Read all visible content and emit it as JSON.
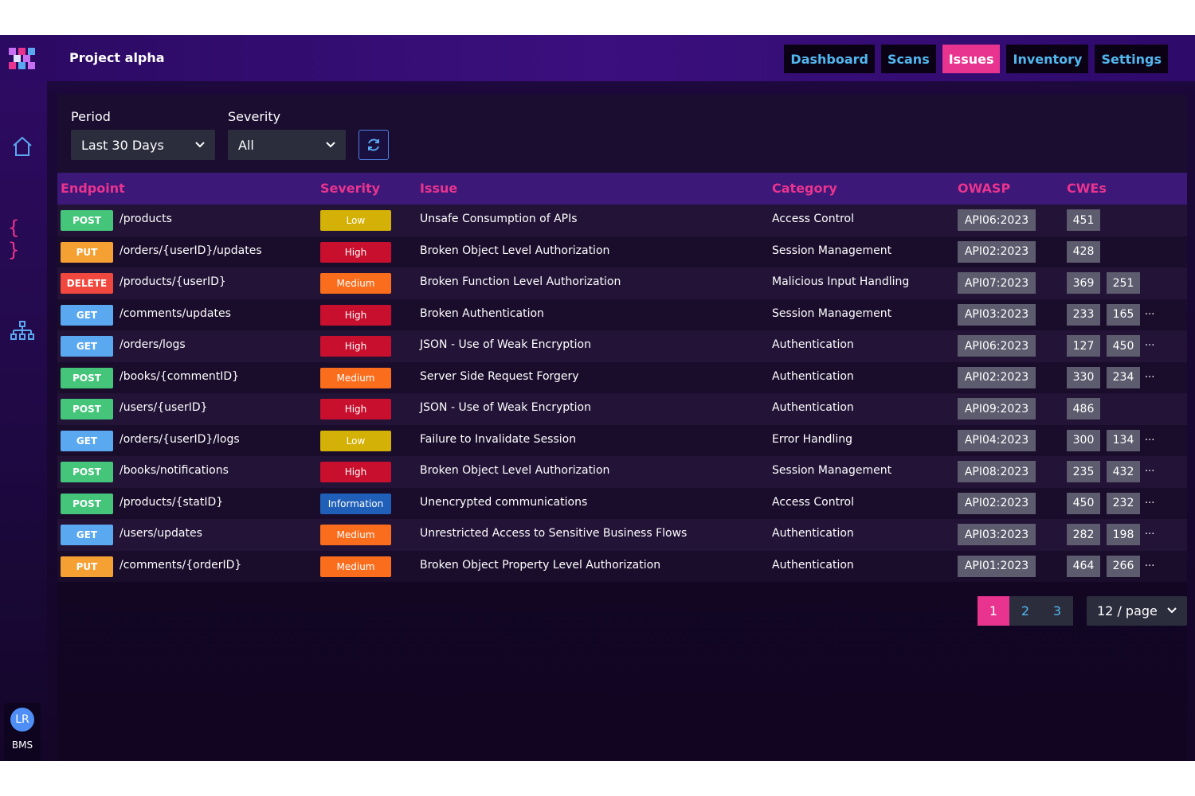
{
  "header": {
    "project_title": "Project alpha",
    "nav": [
      {
        "label": "Dashboard",
        "active": false
      },
      {
        "label": "Scans",
        "active": false
      },
      {
        "label": "Issues",
        "active": true
      },
      {
        "label": "Inventory",
        "active": false
      },
      {
        "label": "Settings",
        "active": false
      }
    ]
  },
  "sidebar": {
    "icons": [
      "home-icon",
      "code-braces-icon",
      "network-tree-icon"
    ],
    "user": {
      "initials": "LR",
      "label": "BMS"
    }
  },
  "filters": {
    "period": {
      "label": "Period",
      "value": "Last 30 Days"
    },
    "severity": {
      "label": "Severity",
      "value": "All"
    }
  },
  "table": {
    "headers": {
      "endpoint": "Endpoint",
      "severity": "Severity",
      "issue": "Issue",
      "category": "Category",
      "owasp": "OWASP",
      "cwes": "CWEs"
    },
    "rows": [
      {
        "method": "POST",
        "path": "/products",
        "severity": "Low",
        "issue": "Unsafe Consumption of APIs",
        "category": "Access Control",
        "owasp": "API06:2023",
        "cwes": [
          "451"
        ],
        "more": ""
      },
      {
        "method": "PUT",
        "path": "/orders/{userID}/updates",
        "severity": "High",
        "issue": "Broken Object Level Authorization",
        "category": "Session Management",
        "owasp": "API02:2023",
        "cwes": [
          "428"
        ],
        "more": ""
      },
      {
        "method": "DELETE",
        "path": "/products/{userID}",
        "severity": "Medium",
        "issue": "Broken Function Level Authorization",
        "category": "Malicious Input Handling",
        "owasp": "API07:2023",
        "cwes": [
          "369",
          "251"
        ],
        "more": ""
      },
      {
        "method": "GET",
        "path": "/comments/updates",
        "severity": "High",
        "issue": "Broken Authentication",
        "category": "Session Management",
        "owasp": "API03:2023",
        "cwes": [
          "233",
          "165"
        ],
        "more": "..."
      },
      {
        "method": "GET",
        "path": "/orders/logs",
        "severity": "High",
        "issue": "JSON - Use of Weak Encryption",
        "category": "Authentication",
        "owasp": "API06:2023",
        "cwes": [
          "127",
          "450"
        ],
        "more": "..."
      },
      {
        "method": "POST",
        "path": "/books/{commentID}",
        "severity": "Medium",
        "issue": "Server Side Request Forgery",
        "category": "Authentication",
        "owasp": "API02:2023",
        "cwes": [
          "330",
          "234"
        ],
        "more": "..."
      },
      {
        "method": "POST",
        "path": "/users/{userID}",
        "severity": "High",
        "issue": "JSON - Use of Weak Encryption",
        "category": "Authentication",
        "owasp": "API09:2023",
        "cwes": [
          "486"
        ],
        "more": ""
      },
      {
        "method": "GET",
        "path": "/orders/{userID}/logs",
        "severity": "Low",
        "issue": "Failure to Invalidate Session",
        "category": "Error Handling",
        "owasp": "API04:2023",
        "cwes": [
          "300",
          "134"
        ],
        "more": "..."
      },
      {
        "method": "POST",
        "path": "/books/notifications",
        "severity": "High",
        "issue": "Broken Object Level Authorization",
        "category": "Session Management",
        "owasp": "API08:2023",
        "cwes": [
          "235",
          "432"
        ],
        "more": "..."
      },
      {
        "method": "POST",
        "path": "/products/{statID}",
        "severity": "Information",
        "issue": "Unencrypted communications",
        "category": "Access Control",
        "owasp": "API02:2023",
        "cwes": [
          "450",
          "232"
        ],
        "more": "..."
      },
      {
        "method": "GET",
        "path": "/users/updates",
        "severity": "Medium",
        "issue": "Unrestricted Access to Sensitive Business Flows",
        "category": "Authentication",
        "owasp": "API03:2023",
        "cwes": [
          "282",
          "198"
        ],
        "more": "..."
      },
      {
        "method": "PUT",
        "path": "/comments/{orderID}",
        "severity": "Medium",
        "issue": "Broken Object Property Level Authorization",
        "category": "Authentication",
        "owasp": "API01:2023",
        "cwes": [
          "464",
          "266"
        ],
        "more": "..."
      }
    ]
  },
  "pagination": {
    "pages": [
      "1",
      "2",
      "3"
    ],
    "current": "1",
    "page_size": "12 / page"
  },
  "colors": {
    "accent": "#e8348f",
    "nav_text": "#52b7ee",
    "method": {
      "POST": "#44c57a",
      "PUT": "#f5a033",
      "DELETE": "#f0483e",
      "GET": "#5aa8f0"
    },
    "severity": {
      "Low": "#d4b106",
      "High": "#c8102e",
      "Medium": "#fa6d1c",
      "Information": "#1f5fb8"
    }
  }
}
